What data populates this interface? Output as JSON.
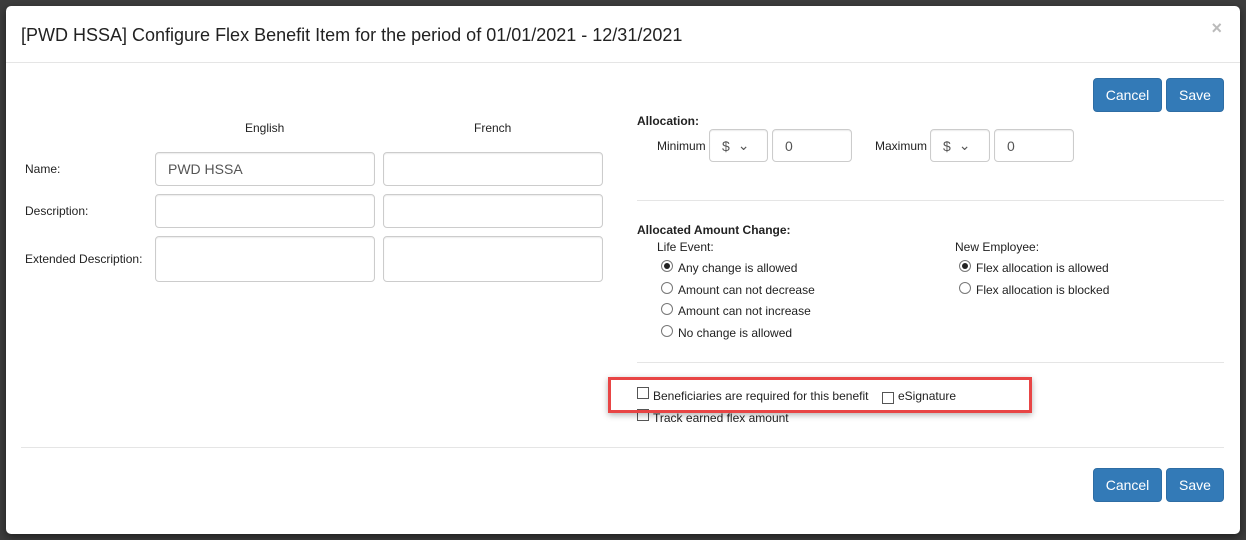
{
  "dialog": {
    "title": "[PWD HSSA] Configure Flex Benefit Item for the period of 01/01/2021 - 12/31/2021",
    "close": "×"
  },
  "buttons": {
    "cancel": "Cancel",
    "save": "Save"
  },
  "languages": {
    "english": "English",
    "french": "French"
  },
  "fields": {
    "name": {
      "label": "Name:",
      "english": "PWD HSSA",
      "french": ""
    },
    "description": {
      "label": "Description:",
      "english": "",
      "french": ""
    },
    "extended_description": {
      "label": "Extended Description:",
      "english": "",
      "french": ""
    }
  },
  "allocation": {
    "heading": "Allocation:",
    "minimum_label": "Minimum",
    "minimum_currency": "$",
    "minimum_value": "0",
    "maximum_label": "Maximum",
    "maximum_currency": "$",
    "maximum_value": "0"
  },
  "amount_change": {
    "heading": "Allocated Amount Change:",
    "life_event": {
      "label": "Life Event:",
      "options": [
        "Any change is allowed",
        "Amount can not decrease",
        "Amount can not increase",
        "No change is allowed"
      ],
      "selected": 0
    },
    "new_employee": {
      "label": "New Employee:",
      "options": [
        "Flex allocation is allowed",
        "Flex allocation is blocked"
      ],
      "selected": 0
    }
  },
  "checkboxes": {
    "beneficiaries": "Beneficiaries are required for this benefit",
    "esignature": "eSignature",
    "track": "Track earned flex amount"
  }
}
